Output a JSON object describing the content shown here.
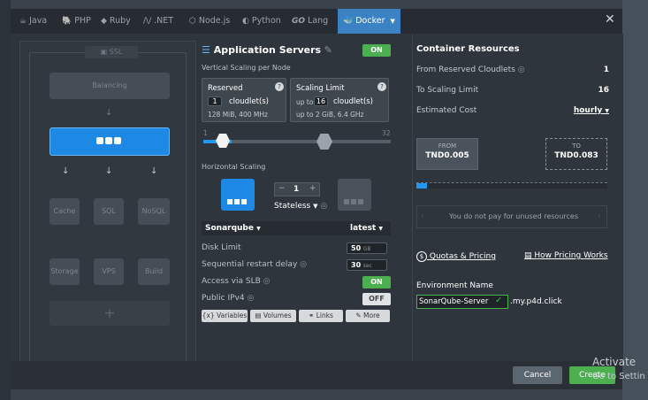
{
  "tabs": [
    {
      "icon": "java-icon",
      "label": "Java"
    },
    {
      "icon": "php-icon",
      "label": "PHP"
    },
    {
      "icon": "ruby-icon",
      "label": "Ruby"
    },
    {
      "icon": "dotnet-icon",
      "label": ".NET"
    },
    {
      "icon": "nodejs-icon",
      "label": "Node.js"
    },
    {
      "icon": "python-icon",
      "label": "Python"
    },
    {
      "icon": "go-icon",
      "label": "Lang"
    },
    {
      "icon": "docker-icon",
      "label": "Docker"
    }
  ],
  "left": {
    "ssl": "SSL",
    "balancing": "Balancing",
    "cache": "Cache",
    "sql": "SQL",
    "nosql": "NoSQL",
    "storage": "Storage",
    "vps": "VPS",
    "build": "Build"
  },
  "mid": {
    "title": "Application Servers",
    "toggle": "ON",
    "vertical_label": "Vertical Scaling per Node",
    "reserved_title": "Reserved",
    "reserved_value": "1",
    "reserved_unit": "cloudlet(s)",
    "reserved_specs": "128 MiB, 400 MHz",
    "limit_title": "Scaling Limit",
    "limit_prefix": "up to",
    "limit_value": "16",
    "limit_unit": "cloudlet(s)",
    "limit_specs_prefix": "up to",
    "limit_specs": "2 GiB, 6.4 GHz",
    "slider_max": "32",
    "horizontal_label": "Horizontal Scaling",
    "node_count": "1",
    "stateless": "Stateless",
    "image": "Sonarqube",
    "tag": "latest",
    "disk_limit_label": "Disk Limit",
    "disk_limit": "50",
    "disk_unit": "GB",
    "restart_label": "Sequential restart delay",
    "restart_value": "30",
    "restart_unit": "sec",
    "slb_label": "Access via SLB",
    "slb_toggle": "ON",
    "ipv4_label": "Public IPv4",
    "ipv4_toggle": "OFF",
    "buttons": [
      "Variables",
      "Volumes",
      "Links",
      "More"
    ]
  },
  "right": {
    "title": "Container Resources",
    "reserved_label": "From Reserved Cloudlets",
    "reserved_value": "1",
    "limit_label": "To Scaling Limit",
    "limit_value": "16",
    "cost_label": "Estimated Cost",
    "cost_period": "hourly",
    "from_label": "FROM",
    "from_value": "TND0.005",
    "to_label": "TO",
    "to_value": "TND0.083",
    "unused_note": "You do not pay for unused resources",
    "quotas": "Quotas & Pricing",
    "how_pricing": "How Pricing Works",
    "env_label": "Environment Name",
    "env_value": "SonarQube-Server",
    "env_domain": ".my.p4d.click"
  },
  "footer": {
    "cancel": "Cancel",
    "create": "Create"
  },
  "watermark": "Activate",
  "watermark2": "Go to Settin"
}
